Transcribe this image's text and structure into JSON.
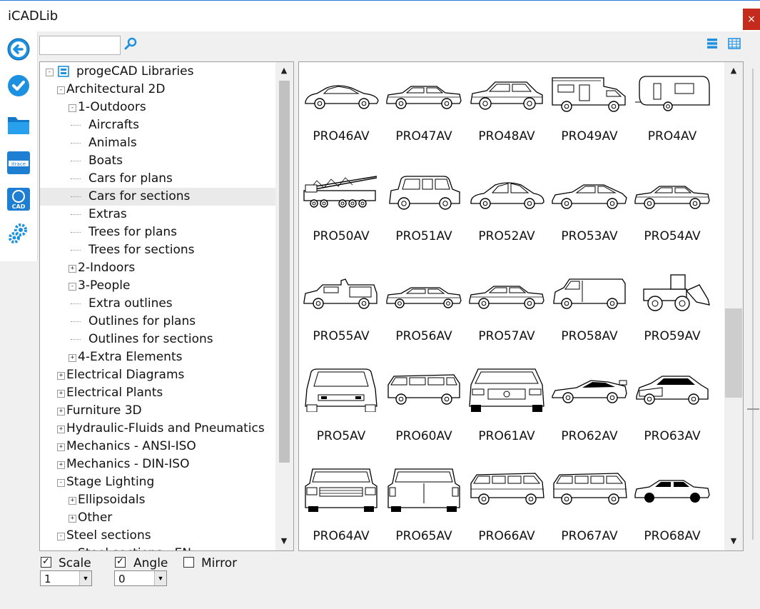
{
  "window": {
    "title": "iCADLib",
    "close_label": "×"
  },
  "sidebar": {
    "buttons": [
      {
        "name": "back-icon",
        "color": "#1e90e0"
      },
      {
        "name": "check-icon",
        "color": "#1e90e0"
      },
      {
        "name": "folder-icon",
        "color": "#1e90e0"
      },
      {
        "name": "itrace-icon",
        "label": "itrace"
      },
      {
        "name": "cad-icon",
        "label": "CAD"
      },
      {
        "name": "gears-icon",
        "color": "#1e90e0"
      }
    ]
  },
  "search": {
    "value": "",
    "placeholder": ""
  },
  "tree": {
    "root": "progeCAD Libraries",
    "rows": [
      {
        "label": "progeCAD Libraries",
        "indent": 0,
        "toggle": "-"
      },
      {
        "label": "Architectural 2D",
        "indent": 1,
        "toggle": "-"
      },
      {
        "label": "1-Outdoors",
        "indent": 2,
        "toggle": "-"
      },
      {
        "label": "Aircrafts",
        "indent": 3,
        "toggle": ""
      },
      {
        "label": "Animals",
        "indent": 3,
        "toggle": ""
      },
      {
        "label": "Boats",
        "indent": 3,
        "toggle": ""
      },
      {
        "label": "Cars for plans",
        "indent": 3,
        "toggle": ""
      },
      {
        "label": "Cars for sections",
        "indent": 3,
        "toggle": "",
        "selected": true
      },
      {
        "label": "Extras",
        "indent": 3,
        "toggle": ""
      },
      {
        "label": "Trees for plans",
        "indent": 3,
        "toggle": ""
      },
      {
        "label": "Trees for sections",
        "indent": 3,
        "toggle": ""
      },
      {
        "label": "2-Indoors",
        "indent": 2,
        "toggle": "+"
      },
      {
        "label": "3-People",
        "indent": 2,
        "toggle": "-"
      },
      {
        "label": "Extra outlines",
        "indent": 3,
        "toggle": ""
      },
      {
        "label": "Outlines for plans",
        "indent": 3,
        "toggle": ""
      },
      {
        "label": "Outlines for sections",
        "indent": 3,
        "toggle": ""
      },
      {
        "label": "4-Extra Elements",
        "indent": 2,
        "toggle": "+"
      },
      {
        "label": "Electrical Diagrams",
        "indent": 1,
        "toggle": "+"
      },
      {
        "label": "Electrical Plants",
        "indent": 1,
        "toggle": "+"
      },
      {
        "label": "Furniture 3D",
        "indent": 1,
        "toggle": "+"
      },
      {
        "label": "Hydraulic-Fluids and Pneumatics",
        "indent": 1,
        "toggle": "+"
      },
      {
        "label": "Mechanics - ANSI-ISO",
        "indent": 1,
        "toggle": "+"
      },
      {
        "label": "Mechanics - DIN-ISO",
        "indent": 1,
        "toggle": "+"
      },
      {
        "label": "Stage Lighting",
        "indent": 1,
        "toggle": "-"
      },
      {
        "label": "Ellipsoidals",
        "indent": 2,
        "toggle": "+"
      },
      {
        "label": "Other",
        "indent": 2,
        "toggle": "+"
      },
      {
        "label": "Steel sections",
        "indent": 1,
        "toggle": "-"
      },
      {
        "label": "Steel sections - EN",
        "indent": 2,
        "toggle": "+"
      }
    ]
  },
  "grid": {
    "items": [
      {
        "label": "PRO46AV",
        "shape": "sedan-low"
      },
      {
        "label": "PRO47AV",
        "shape": "sedan"
      },
      {
        "label": "PRO48AV",
        "shape": "hatch"
      },
      {
        "label": "PRO49AV",
        "shape": "camper"
      },
      {
        "label": "PRO4AV",
        "shape": "caravan"
      },
      {
        "label": "PRO50AV",
        "shape": "crane"
      },
      {
        "label": "PRO51AV",
        "shape": "mini"
      },
      {
        "label": "PRO52AV",
        "shape": "coupe"
      },
      {
        "label": "PRO53AV",
        "shape": "fastback"
      },
      {
        "label": "PRO54AV",
        "shape": "sedan"
      },
      {
        "label": "PRO55AV",
        "shape": "ambulance"
      },
      {
        "label": "PRO56AV",
        "shape": "sedan-long"
      },
      {
        "label": "PRO57AV",
        "shape": "sedan"
      },
      {
        "label": "PRO58AV",
        "shape": "van"
      },
      {
        "label": "PRO59AV",
        "shape": "loader"
      },
      {
        "label": "PRO5AV",
        "shape": "rear-view"
      },
      {
        "label": "PRO60AV",
        "shape": "minivan"
      },
      {
        "label": "PRO61AV",
        "shape": "front-view"
      },
      {
        "label": "PRO62AV",
        "shape": "sports"
      },
      {
        "label": "PRO63AV",
        "shape": "persp-car"
      },
      {
        "label": "PRO64AV",
        "shape": "front-suv"
      },
      {
        "label": "PRO65AV",
        "shape": "rear-suv"
      },
      {
        "label": "PRO66AV",
        "shape": "minibus"
      },
      {
        "label": "PRO67AV",
        "shape": "minibus"
      },
      {
        "label": "PRO68AV",
        "shape": "sedan-solid"
      }
    ]
  },
  "options": {
    "scale": {
      "label": "Scale",
      "checked": "✓",
      "value": "1"
    },
    "angle": {
      "label": "Angle",
      "checked": "✓",
      "value": "0"
    },
    "mirror": {
      "label": "Mirror",
      "checked": ""
    }
  }
}
